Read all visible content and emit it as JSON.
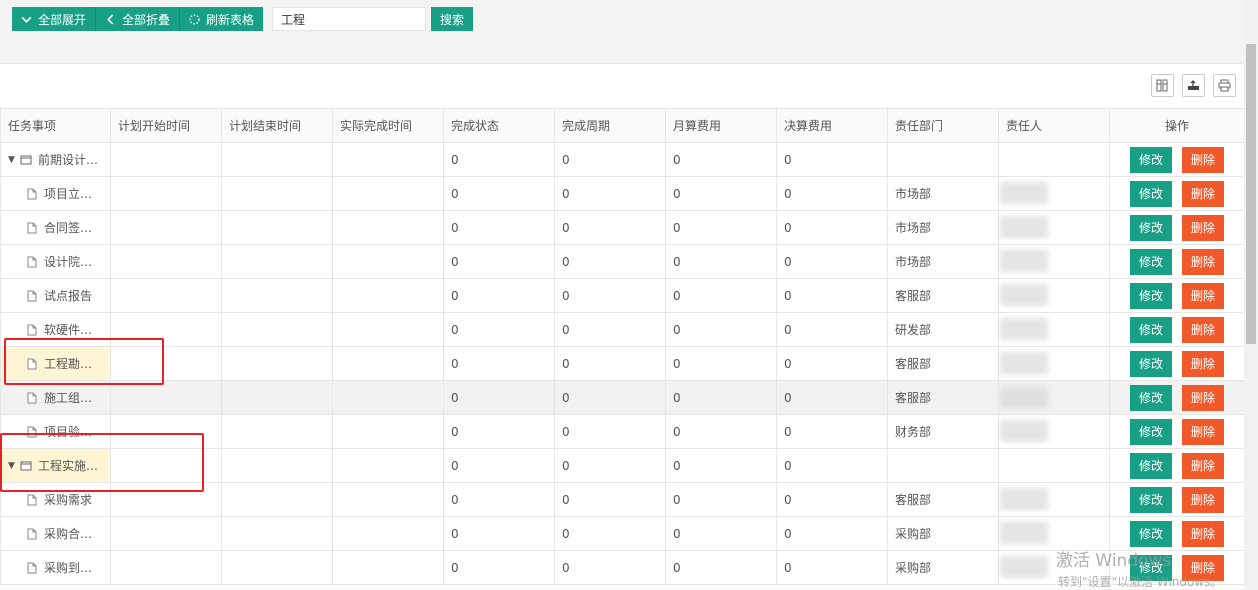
{
  "toolbar": {
    "expand_all": "全部展开",
    "collapse_all": "全部折叠",
    "refresh": "刷新表格",
    "search_value": "工程",
    "search_btn": "搜索"
  },
  "columns": [
    "任务事项",
    "计划开始时间",
    "计划结束时间",
    "实际完成时间",
    "完成状态",
    "完成周期",
    "月算费用",
    "决算费用",
    "责任部门",
    "责任人",
    "操作"
  ],
  "actions": {
    "edit": "修改",
    "delete": "删除"
  },
  "rows": [
    {
      "name": "前期设计…",
      "level": 0,
      "state": "0",
      "cycle": "0",
      "month": "0",
      "final": "0",
      "dept": ""
    },
    {
      "name": "项目立…",
      "level": 1,
      "state": "0",
      "cycle": "0",
      "month": "0",
      "final": "0",
      "dept": "市场部"
    },
    {
      "name": "合同签…",
      "level": 1,
      "state": "0",
      "cycle": "0",
      "month": "0",
      "final": "0",
      "dept": "市场部"
    },
    {
      "name": "设计院…",
      "level": 1,
      "state": "0",
      "cycle": "0",
      "month": "0",
      "final": "0",
      "dept": "市场部"
    },
    {
      "name": "试点报告",
      "level": 1,
      "state": "0",
      "cycle": "0",
      "month": "0",
      "final": "0",
      "dept": "客服部"
    },
    {
      "name": "软硬件…",
      "level": 1,
      "state": "0",
      "cycle": "0",
      "month": "0",
      "final": "0",
      "dept": "研发部"
    },
    {
      "name": "工程勘…",
      "level": 1,
      "state": "0",
      "cycle": "0",
      "month": "0",
      "final": "0",
      "dept": "客服部",
      "highlight": true
    },
    {
      "name": "施工组…",
      "level": 1,
      "state": "0",
      "cycle": "0",
      "month": "0",
      "final": "0",
      "dept": "客服部",
      "selected": true
    },
    {
      "name": "项目验…",
      "level": 1,
      "state": "0",
      "cycle": "0",
      "month": "0",
      "final": "0",
      "dept": "财务部"
    },
    {
      "name": "工程实施…",
      "level": 0,
      "state": "0",
      "cycle": "0",
      "month": "0",
      "final": "0",
      "dept": "",
      "highlight": true
    },
    {
      "name": "采购需求",
      "level": 1,
      "state": "0",
      "cycle": "0",
      "month": "0",
      "final": "0",
      "dept": "客服部"
    },
    {
      "name": "采购合…",
      "level": 1,
      "state": "0",
      "cycle": "0",
      "month": "0",
      "final": "0",
      "dept": "采购部"
    },
    {
      "name": "采购到…",
      "level": 1,
      "state": "0",
      "cycle": "0",
      "month": "0",
      "final": "0",
      "dept": "采购部"
    }
  ],
  "watermark": {
    "line1": "激活 Windows",
    "line2": "转到\"设置\"以激活 Windows。"
  }
}
